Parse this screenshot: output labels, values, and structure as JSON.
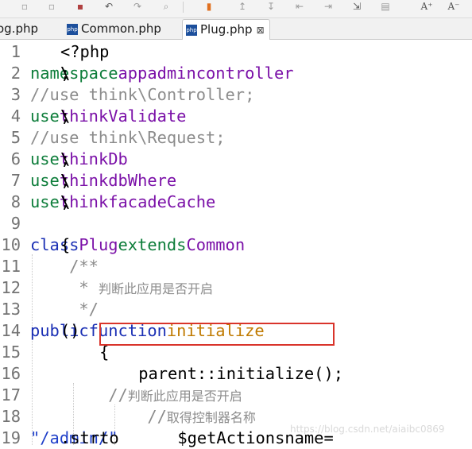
{
  "tabs": [
    {
      "label": "og.php",
      "active": false
    },
    {
      "label": "Common.php",
      "active": false
    },
    {
      "label": "Plug.php",
      "active": true,
      "close": "⊠"
    }
  ],
  "editor": {
    "lines": [
      {
        "num": "1",
        "tokens": [
          {
            "t": "<?php",
            "c": "code"
          }
        ]
      },
      {
        "num": "2",
        "tokens": [
          {
            "t": "namespace",
            "c": "kw"
          },
          {
            "t": " ",
            "c": "code"
          },
          {
            "t": "app",
            "c": "ns"
          },
          {
            "t": "\\",
            "c": "code"
          },
          {
            "t": "admin",
            "c": "ns"
          },
          {
            "t": "\\",
            "c": "code"
          },
          {
            "t": "controller",
            "c": "ns"
          },
          {
            "t": ";",
            "c": "code"
          }
        ]
      },
      {
        "num": "3",
        "tokens": [
          {
            "t": "//use think\\Controller;",
            "c": "cm"
          }
        ]
      },
      {
        "num": "4",
        "tokens": [
          {
            "t": "use",
            "c": "kw"
          },
          {
            "t": " ",
            "c": "code"
          },
          {
            "t": "think",
            "c": "ns"
          },
          {
            "t": "\\",
            "c": "code"
          },
          {
            "t": "Validate",
            "c": "ns"
          },
          {
            "t": ";",
            "c": "code"
          }
        ]
      },
      {
        "num": "5",
        "tokens": [
          {
            "t": "//use think\\Request;",
            "c": "cm"
          }
        ]
      },
      {
        "num": "6",
        "tokens": [
          {
            "t": "use",
            "c": "kw"
          },
          {
            "t": " ",
            "c": "code"
          },
          {
            "t": "think",
            "c": "ns"
          },
          {
            "t": "\\",
            "c": "code"
          },
          {
            "t": "Db",
            "c": "ns"
          },
          {
            "t": ";",
            "c": "code"
          }
        ]
      },
      {
        "num": "7",
        "tokens": [
          {
            "t": "use",
            "c": "kw"
          },
          {
            "t": " ",
            "c": "code"
          },
          {
            "t": "think",
            "c": "ns"
          },
          {
            "t": "\\",
            "c": "code"
          },
          {
            "t": "db",
            "c": "ns"
          },
          {
            "t": "\\",
            "c": "code"
          },
          {
            "t": "Where",
            "c": "ns"
          },
          {
            "t": ";",
            "c": "code"
          }
        ]
      },
      {
        "num": "8",
        "tokens": [
          {
            "t": "use",
            "c": "kw"
          },
          {
            "t": " ",
            "c": "code"
          },
          {
            "t": "think",
            "c": "ns"
          },
          {
            "t": "\\",
            "c": "code"
          },
          {
            "t": "facade",
            "c": "ns"
          },
          {
            "t": "\\",
            "c": "code"
          },
          {
            "t": "Cache",
            "c": "ns"
          },
          {
            "t": ";",
            "c": "code"
          }
        ]
      },
      {
        "num": "9",
        "tokens": []
      },
      {
        "num": "10",
        "tokens": [
          {
            "t": "class",
            "c": "kwb"
          },
          {
            "t": " ",
            "c": "code"
          },
          {
            "t": "Plug",
            "c": "ns"
          },
          {
            "t": " ",
            "c": "code"
          },
          {
            "t": "extends",
            "c": "kw"
          },
          {
            "t": " ",
            "c": "code"
          },
          {
            "t": "Common",
            "c": "ns"
          },
          {
            "t": "{",
            "c": "code"
          }
        ]
      },
      {
        "num": "11",
        "tokens": [
          {
            "t": "    /**",
            "c": "cm"
          }
        ]
      },
      {
        "num": "12",
        "tokens": [
          {
            "t": "     * ",
            "c": "cm"
          },
          {
            "t": "判断此应用是否开启",
            "c": "cm cmt-cjk"
          }
        ]
      },
      {
        "num": "13",
        "tokens": [
          {
            "t": "     */",
            "c": "cm"
          }
        ]
      },
      {
        "num": "14",
        "tokens": [
          {
            "t": "    ",
            "c": "code"
          },
          {
            "t": "public",
            "c": "kwb"
          },
          {
            "t": " ",
            "c": "code"
          },
          {
            "t": "function",
            "c": "kwb"
          },
          {
            "t": " ",
            "c": "code"
          },
          {
            "t": "initialize",
            "c": "fn"
          },
          {
            "t": "()",
            "c": "code"
          }
        ]
      },
      {
        "num": "15",
        "tokens": [
          {
            "t": "    {",
            "c": "code"
          }
        ]
      },
      {
        "num": "16",
        "tokens": [
          {
            "t": "        parent::initialize();",
            "c": "code"
          }
        ]
      },
      {
        "num": "17",
        "tokens": [
          {
            "t": "        //",
            "c": "cm"
          },
          {
            "t": "判断此应用是否开启",
            "c": "cm cmt-cjk"
          }
        ]
      },
      {
        "num": "18",
        "tokens": [
          {
            "t": "            //",
            "c": "cm"
          },
          {
            "t": "取得控制器名称",
            "c": "cm cmt-cjk"
          }
        ]
      },
      {
        "num": "19",
        "tokens": [
          {
            "t": "            $getActionsname=",
            "c": "code"
          },
          {
            "t": "\"/admin/\"",
            "c": "str"
          },
          {
            "t": ".strto",
            "c": "code"
          }
        ]
      }
    ]
  },
  "watermark": "https://blog.csdn.net/aiaibc0869"
}
